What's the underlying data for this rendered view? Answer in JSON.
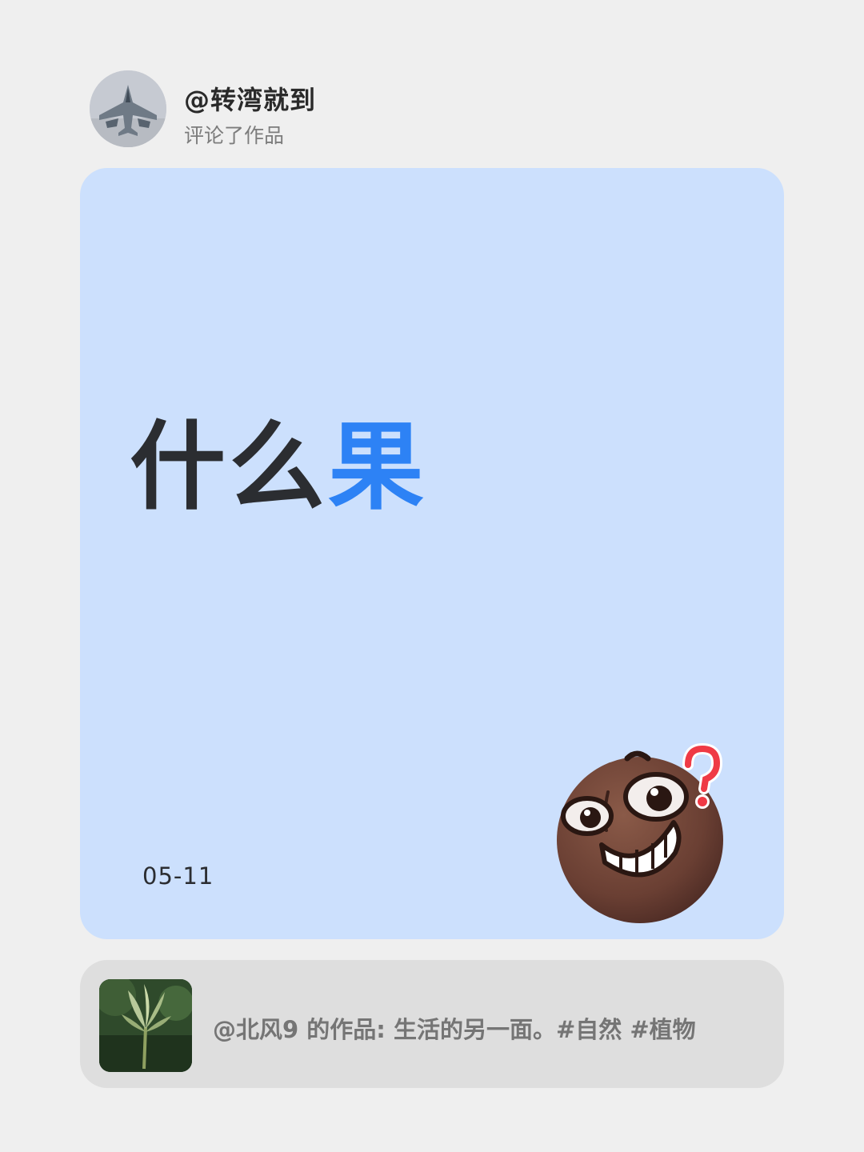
{
  "author": {
    "avatar_icon": "fighter-jet-avatar",
    "username": "@转湾就到",
    "action": "评论了作品"
  },
  "card": {
    "text_main": "什么",
    "text_accent": "果",
    "date": "05-11",
    "sticker_icon": "confused-grin-emoji",
    "colors": {
      "background": "#cce0fd",
      "accent": "#2d82f5",
      "text": "#2b2d31"
    }
  },
  "quoted_work": {
    "thumbnail_icon": "plant-sprout-thumbnail",
    "text": "@北风9 的作品: 生活的另一面。#自然 #植物"
  }
}
